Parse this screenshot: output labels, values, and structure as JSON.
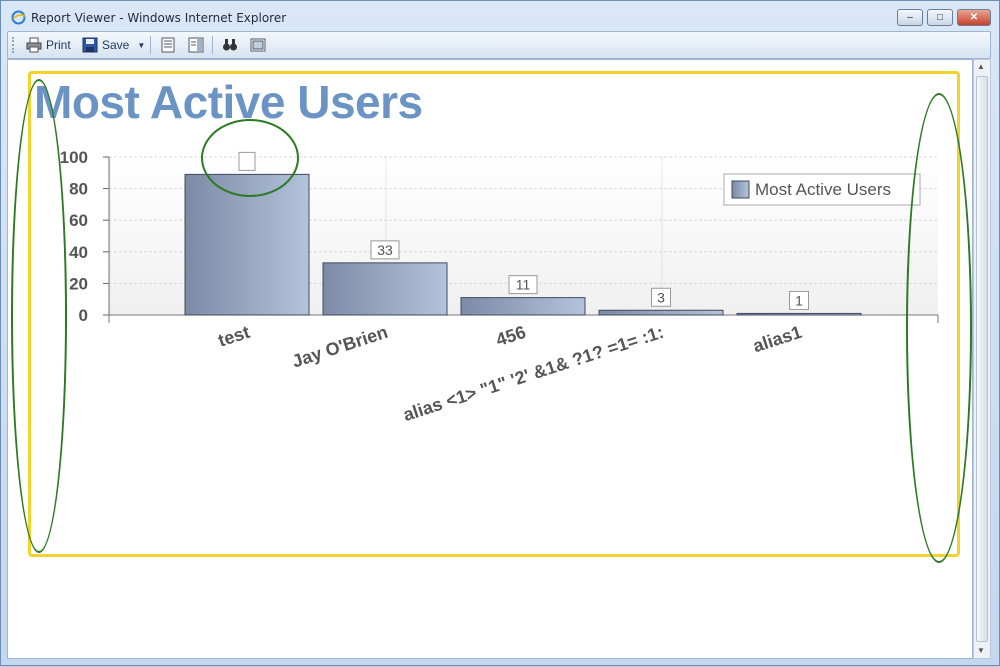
{
  "window": {
    "title": "Report Viewer - Windows Internet Explorer",
    "minimize": "–",
    "maximize": "□",
    "close": "✕"
  },
  "toolbar": {
    "print_label": "Print",
    "save_label": "Save"
  },
  "report": {
    "title": "Most Active Users"
  },
  "chart_data": {
    "type": "bar",
    "title": "Most Active Users",
    "categories": [
      "test",
      "Jay O'Brien",
      "456",
      "alias <1> \"1\" '2' &1& ?1? =1= :1:",
      "alias1"
    ],
    "series": [
      {
        "name": "Most Active Users",
        "values": [
          89,
          33,
          11,
          3,
          1
        ]
      }
    ],
    "data_labels": [
      "",
      "33",
      "11",
      "3",
      "1"
    ],
    "y_ticks": [
      0,
      20,
      40,
      60,
      80,
      100
    ],
    "ylim": [
      0,
      100
    ],
    "legend": {
      "label": "Most Active Users",
      "position": "top-right"
    },
    "grid": true,
    "colors": {
      "bar_start": "#7b8ba5",
      "bar_end": "#b3c3db",
      "bar_border": "#3f4a5c"
    }
  }
}
